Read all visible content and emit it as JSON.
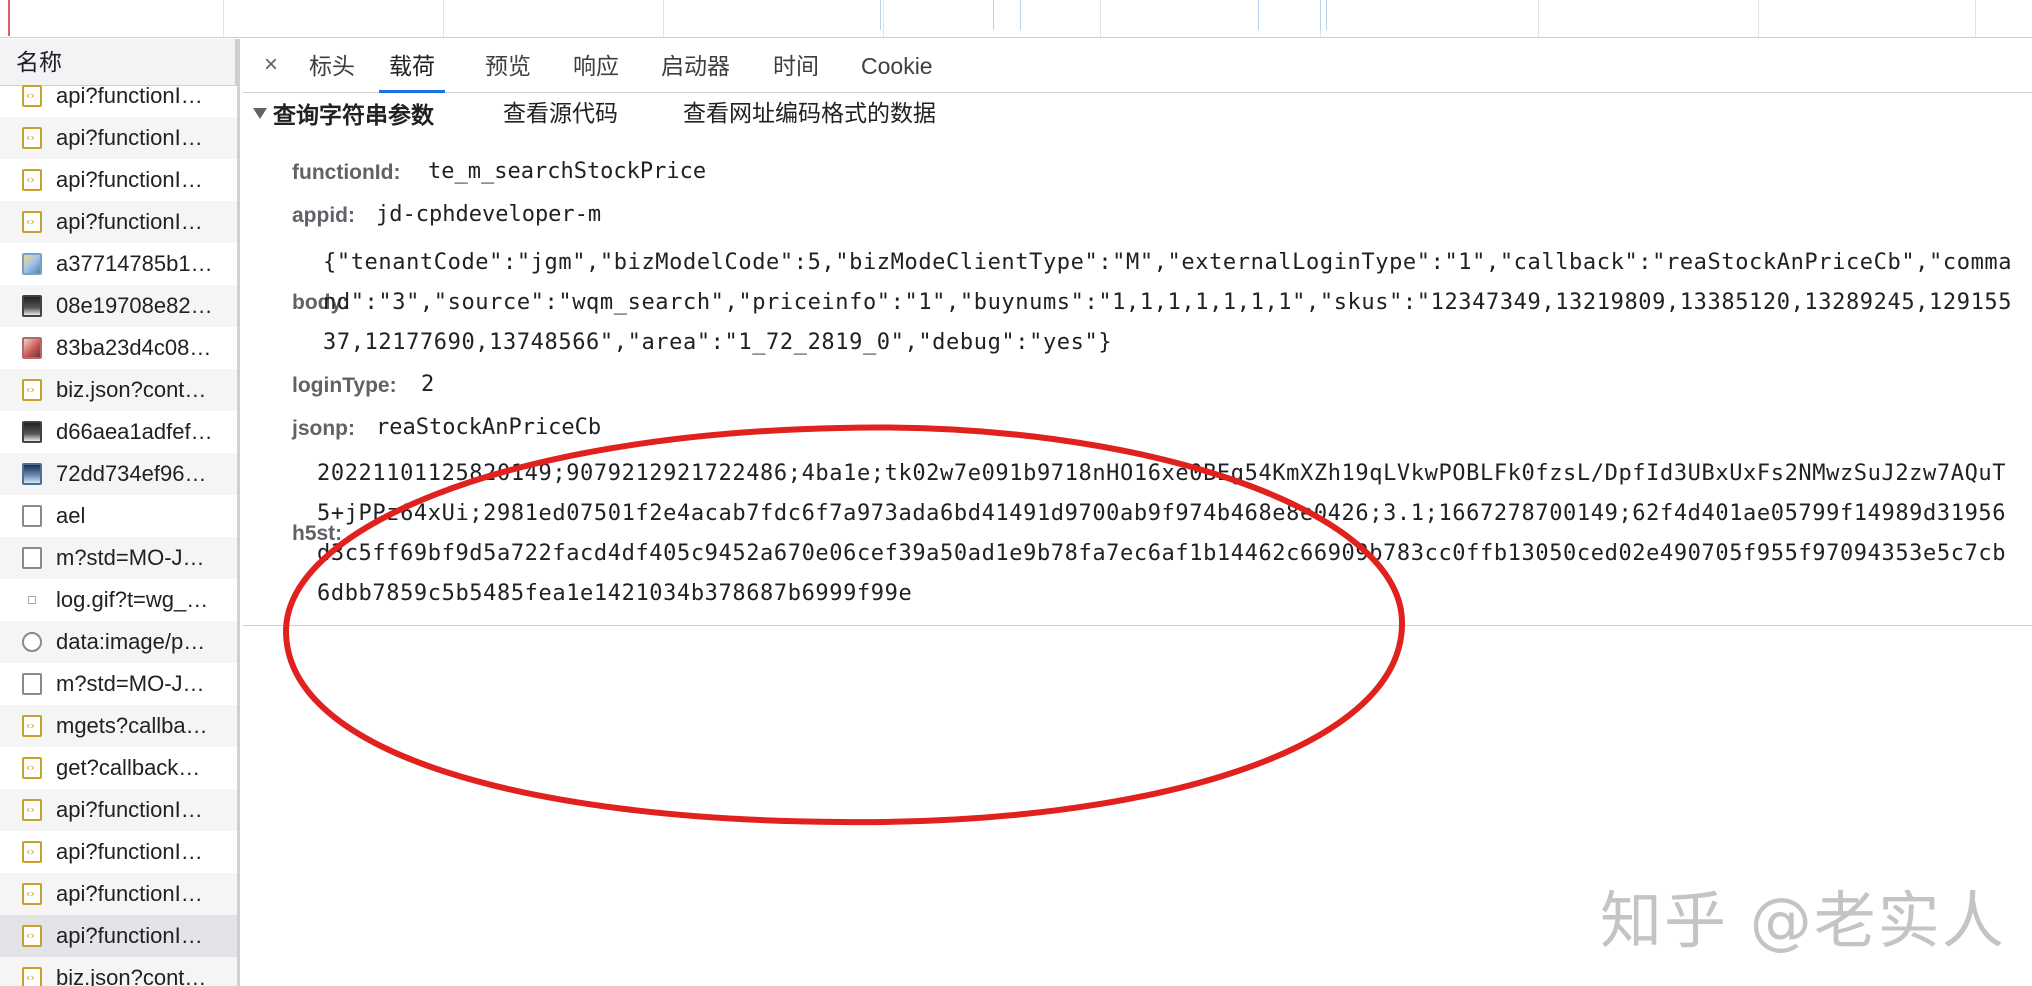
{
  "list": {
    "header": "名称",
    "items": [
      {
        "name": "api?functionI…",
        "icon": "script-file-icon"
      },
      {
        "name": "api?functionI…",
        "icon": "script-file-icon"
      },
      {
        "name": "api?functionI…",
        "icon": "script-file-icon"
      },
      {
        "name": "api?functionI…",
        "icon": "script-file-icon"
      },
      {
        "name": "a37714785b1…",
        "icon": "image-thumbnail-icon"
      },
      {
        "name": "08e19708e82…",
        "icon": "image-thumbnail-icon"
      },
      {
        "name": "83ba23d4c08…",
        "icon": "image-thumbnail-icon"
      },
      {
        "name": "biz.json?cont…",
        "icon": "script-file-icon"
      },
      {
        "name": "d66aea1adfef…",
        "icon": "image-thumbnail-icon"
      },
      {
        "name": "72dd734ef96…",
        "icon": "image-thumbnail-icon"
      },
      {
        "name": "ael",
        "icon": "document-icon"
      },
      {
        "name": "m?std=MO-J…",
        "icon": "document-icon"
      },
      {
        "name": "log.gif?t=wg_…",
        "icon": "gif-icon"
      },
      {
        "name": "data:image/p…",
        "icon": "circle-image-icon"
      },
      {
        "name": "m?std=MO-J…",
        "icon": "document-icon"
      },
      {
        "name": "mgets?callba…",
        "icon": "script-file-icon"
      },
      {
        "name": "get?callback…",
        "icon": "script-file-icon"
      },
      {
        "name": "api?functionI…",
        "icon": "script-file-icon"
      },
      {
        "name": "api?functionI…",
        "icon": "script-file-icon"
      },
      {
        "name": "api?functionI…",
        "icon": "script-file-icon"
      },
      {
        "name": "api?functionI…",
        "icon": "script-file-icon"
      },
      {
        "name": "biz.json?cont…",
        "icon": "script-file-icon"
      }
    ],
    "selected_index": 20
  },
  "tabs": {
    "close": "×",
    "items": [
      "标头",
      "载荷",
      "预览",
      "响应",
      "启动器",
      "时间",
      "Cookie"
    ],
    "active": "载荷"
  },
  "payload": {
    "section_title": "查询字符串参数",
    "view_source": "查看源代码",
    "view_url_encoded": "查看网址编码格式的数据",
    "params": {
      "functionId": {
        "key": "functionId:",
        "value": "te_m_searchStockPrice"
      },
      "appid": {
        "key": "appid:",
        "value": "jd-cphdeveloper-m"
      },
      "body": {
        "key": "body:",
        "value": "{\"tenantCode\":\"jgm\",\"bizModelCode\":5,\"bizModeClientType\":\"M\",\"externalLoginType\":\"1\",\"callback\":\"reaStockAnPriceCb\",\"command\":\"3\",\"source\":\"wqm_search\",\"priceinfo\":\"1\",\"buynums\":\"1,1,1,1,1,1,1\",\"skus\":\"12347349,13219809,13385120,13289245,12915537,12177690,13748566\",\"area\":\"1_72_2819_0\",\"debug\":\"yes\"}"
      },
      "loginType": {
        "key": "loginType:",
        "value": "2"
      },
      "jsonp": {
        "key": "jsonp:",
        "value": "reaStockAnPriceCb"
      },
      "h5st": {
        "key": "h5st:",
        "value": "20221101125820149;9079212921722486;4ba1e;tk02w7e091b9718nHO16xe0BEg54KmXZh19qLVkwPOBLFk0fzsL/DpfId3UBxUxFs2NMwzSuJ2zw7AQuT5+jPPz64xUi;2981ed07501f2e4acab7fdc6f7a973ada6bd41491d9700ab9f974b468e8e0426;3.1;1667278700149;62f4d401ae05799f14989d31956d3c5ff69bf9d5a722facd4df405c9452a670e06cef39a50ad1e9b78fa7ec6af1b14462c66909b783cc0ffb13050ced02e490705f955f97094353e5c7cb6dbb7859c5b5485fea1e1421034b378687b6999f99e"
      }
    }
  },
  "annotation": {
    "color": "#e0211d"
  },
  "watermark": "知乎 @老实人"
}
